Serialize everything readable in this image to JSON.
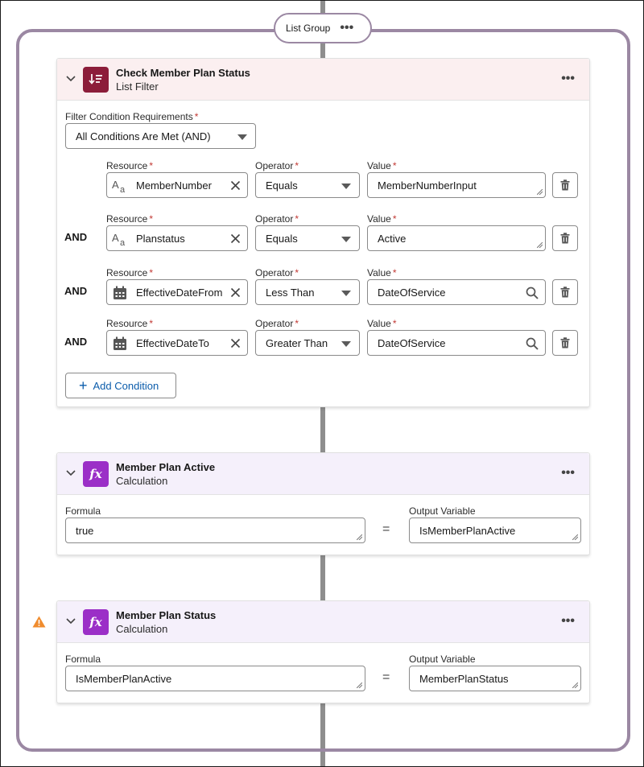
{
  "list_group": {
    "label": "List Group",
    "menu": "•••"
  },
  "filter_card": {
    "title": "Check Member Plan Status",
    "subtitle": "List Filter",
    "menu": "•••",
    "requirements_label": "Filter Condition Requirements",
    "requirements_value": "All Conditions Are Met (AND)",
    "labels": {
      "resource": "Resource",
      "operator": "Operator",
      "value": "Value",
      "required": "*"
    },
    "conditions": [
      {
        "connector": "",
        "resource": "MemberNumber",
        "resource_icon": "text-type-icon",
        "operator": "Equals",
        "value": "MemberNumberInput"
      },
      {
        "connector": "AND",
        "resource": "Planstatus",
        "resource_icon": "text-type-icon",
        "operator": "Equals",
        "value": "Active"
      },
      {
        "connector": "AND",
        "resource": "EffectiveDateFrom",
        "resource_icon": "calendar-icon",
        "operator": "Less Than",
        "value": "DateOfService"
      },
      {
        "connector": "AND",
        "resource": "EffectiveDateTo",
        "resource_icon": "calendar-icon",
        "operator": "Greater Than",
        "value": "DateOfService"
      }
    ],
    "add_condition_label": "Add Condition"
  },
  "calc_cards": [
    {
      "title": "Member Plan Active",
      "subtitle": "Calculation",
      "menu": "•••",
      "formula_label": "Formula",
      "formula_value": "true",
      "equals": "=",
      "output_label": "Output Variable",
      "output_value": "IsMemberPlanActive",
      "warning": false
    },
    {
      "title": "Member Plan Status",
      "subtitle": "Calculation",
      "menu": "•••",
      "formula_label": "Formula",
      "formula_value": "IsMemberPlanActive",
      "equals": "=",
      "output_label": "Output Variable",
      "output_value": "MemberPlanStatus",
      "warning": true
    }
  ],
  "colors": {
    "group_border": "#9b88a3",
    "filter_header": "#fbeff0",
    "filter_tile": "#8c1d3a",
    "calc_header": "#f5f0fb",
    "calc_tile": "#9b2fc7",
    "link": "#0b5cab",
    "required": "#c23934",
    "warning": "#f08c2e"
  }
}
